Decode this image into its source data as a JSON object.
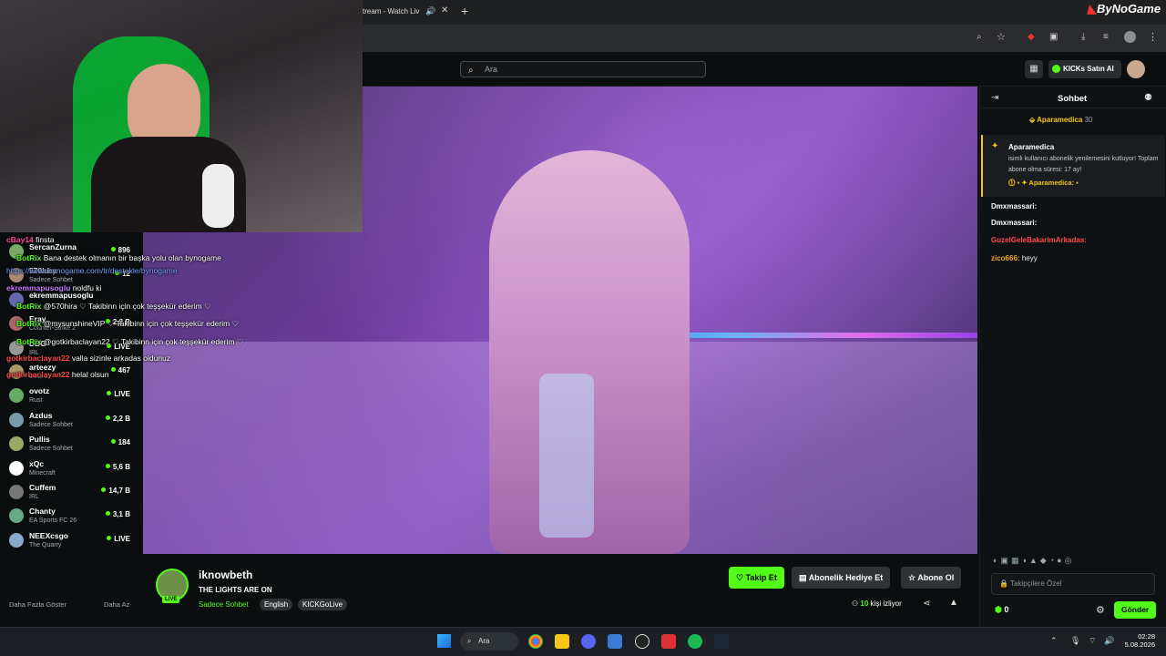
{
  "browser": {
    "tab_title": "tream - Watch Liv",
    "new_tab": "+",
    "watermark": "ByNoGame"
  },
  "header": {
    "search_placeholder": "Ara",
    "kicks_button": "KICKs Satın Al"
  },
  "sidebar": {
    "channels": [
      {
        "name": "SercanZurna",
        "category": "",
        "viewers": "896"
      },
      {
        "name": "570hira",
        "category": "Sadece Sohbet",
        "viewers": "12"
      },
      {
        "name": "ekremmapusoglu",
        "category": "",
        "viewers": ""
      },
      {
        "name": "Eray",
        "category": "Counter-Strike 2",
        "viewers": "2,2 B"
      },
      {
        "name": "DDG",
        "category": "IRL",
        "viewers": "LIVE"
      },
      {
        "name": "arteezy",
        "category": "Dota 2",
        "viewers": "467"
      },
      {
        "name": "ovotz",
        "category": "Rust",
        "viewers": "LIVE"
      },
      {
        "name": "Azdus",
        "category": "Sadece Sohbet",
        "viewers": "2,2 B"
      },
      {
        "name": "Pullis",
        "category": "Sadece Sohbet",
        "viewers": "184"
      },
      {
        "name": "xQc",
        "category": "Minecraft",
        "viewers": "5,6 B"
      },
      {
        "name": "Cuffem",
        "category": "IRL",
        "viewers": "14,7 B"
      },
      {
        "name": "Chanty",
        "category": "EA Sports FC 26",
        "viewers": "3,1 B"
      },
      {
        "name": "NEEXcsgo",
        "category": "The Quarry",
        "viewers": "LIVE"
      }
    ],
    "show_more": "Daha Fazla Göster",
    "show_less": "Daha Az"
  },
  "overlay_chat": [
    {
      "user": "cBay14",
      "text": "finsta"
    },
    {
      "user": "BotRix",
      "text": "Bana destek olmanın bir başka yolu olan bynogame"
    },
    {
      "user": "",
      "text": "https://www.bynogame.com/tr/destekle/bynogame"
    },
    {
      "user": "ekremmapusoglu",
      "text": "noldfu ki"
    },
    {
      "user": "BotRix",
      "text": "@570hira ♡ Takibinn için çok teşşekür ederim ♡"
    },
    {
      "user": "BotRix",
      "text": "@mysunshineVIP ♡ Takibinn için çok teşşekür ederim ♡"
    },
    {
      "user": "BotRix",
      "text": "@gotkirbaclayan22 ♡ Takibinn için çok teşşekür ederim ♡"
    },
    {
      "user": "gotkirbaclayan22",
      "text": "valla sizinle arkadas oldunuz"
    },
    {
      "user": "gotkirbaclayan22",
      "text": "helal olsun"
    }
  ],
  "stream": {
    "streamer": "iknowbeth",
    "live_badge": "LIVE",
    "title": "THE LIGHTS ARE ON",
    "category": "Sadece Sohbet",
    "tags": [
      "English",
      "KICKGoLive"
    ],
    "follow_button": "Takip Et",
    "gift_button": "Abonelik Hediye Et",
    "subscribe_button": "Abone Ol",
    "viewers_count": "10",
    "viewers_label": "kişi izliyor"
  },
  "chat": {
    "title": "Sohbet",
    "pinned_user": "Aparamedica",
    "pinned_count": "30",
    "sub_user": "Aparamedica",
    "sub_text": "isimli kullanıcı abonelik yenilemesini kutluyor! Toplam abone olma süresi: 17 ay!",
    "sub_badge_user": "Aparamedica:",
    "messages": [
      {
        "user": "Dmxmassari:",
        "text": "",
        "color": "#ffffff"
      },
      {
        "user": "Dmxmassari:",
        "text": "",
        "color": "#ffffff"
      },
      {
        "user": "GuzelGeleBakarimArkadas:",
        "text": "",
        "color": "#ff4a4a"
      },
      {
        "user": "zico666:",
        "text": "heyy",
        "color": "#f5a623"
      }
    ],
    "input_placeholder": "Takipçilere Özel",
    "kicks_count": "0",
    "send_button": "Gönder"
  },
  "taskbar": {
    "search_label": "Ara",
    "time": "02:28",
    "date": "5.08.2026"
  },
  "colors": {
    "accent": "#53fc18",
    "background": "#0b0e0f"
  }
}
